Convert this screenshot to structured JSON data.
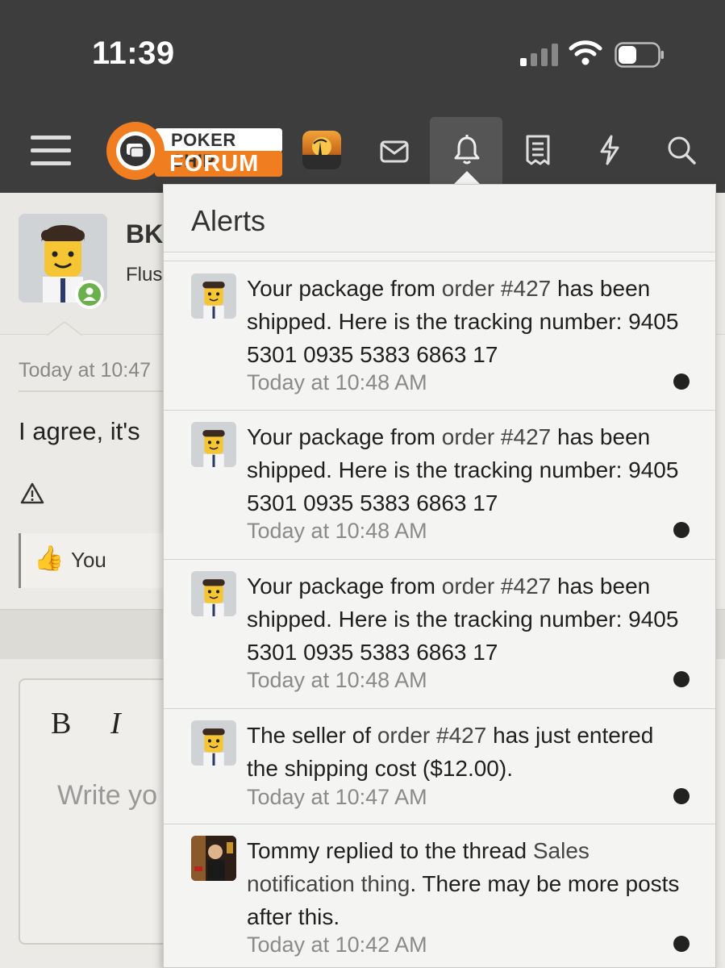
{
  "status_bar": {
    "time": "11:39"
  },
  "navbar": {
    "logo_line1": "POKER CHIP",
    "logo_line2": "FORUM"
  },
  "background_post": {
    "author_name_fragment": "BK",
    "author_role_fragment": "Flus",
    "timestamp_fragment": "Today at 10:47",
    "text_fragment": "I agree, it's",
    "reaction_text": "You",
    "reaction_emoji": "👍",
    "editor": {
      "bold_label": "B",
      "italic_label": "I",
      "placeholder_fragment": "Write yo"
    }
  },
  "alerts": {
    "title": "Alerts",
    "items": [
      {
        "pre": "Your package from ",
        "link": "order #427",
        "post": " has been shipped. Here is the tracking number: 9405 5301 0935 5383 6863 17",
        "time": "Today at 10:48 AM",
        "unread": true
      },
      {
        "pre": "Your package from ",
        "link": "order #427",
        "post": " has been shipped. Here is the tracking number: 9405 5301 0935 5383 6863 17",
        "time": "Today at 10:48 AM",
        "unread": true
      },
      {
        "pre": "Your package from ",
        "link": "order #427",
        "post": " has been shipped. Here is the tracking number: 9405 5301 0935 5383 6863 17",
        "time": "Today at 10:48 AM",
        "unread": true
      },
      {
        "pre": "The seller of ",
        "link": "order #427",
        "post": " has just entered the shipping cost ($12.00).",
        "time": "Today at 10:47 AM",
        "unread": true
      },
      {
        "pre": "Tommy",
        "link_pre": " replied to the thread ",
        "link": "Sales notification thing",
        "post": ". There may be more posts after this.",
        "time": "Today at 10:42 AM",
        "unread": true
      }
    ]
  },
  "colors": {
    "header_bg": "#3d3d3d",
    "logo_orange": "#f07d1f",
    "online_green": "#6ab04c",
    "unread_dot": "#222222"
  }
}
